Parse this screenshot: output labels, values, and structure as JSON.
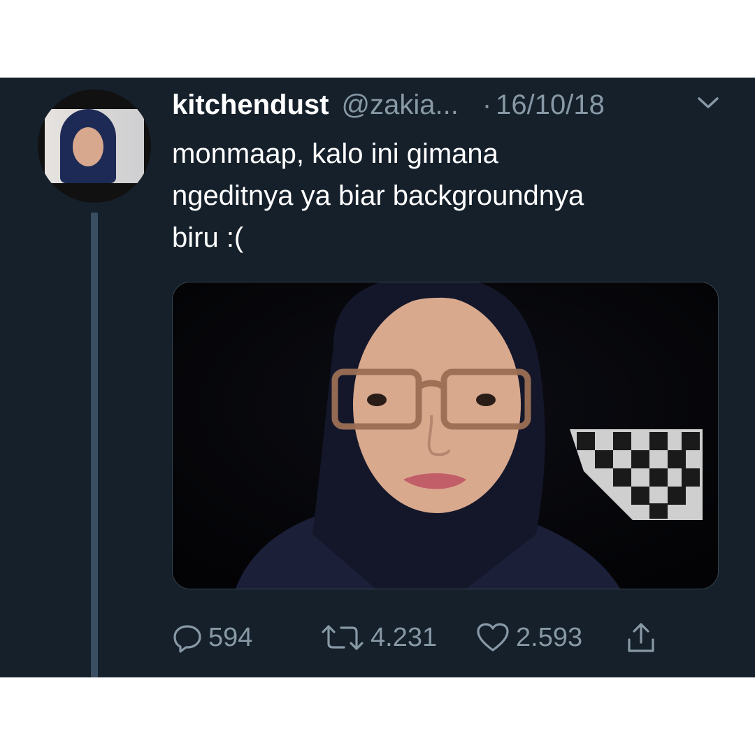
{
  "tweet": {
    "display_name": "kitchendust",
    "handle": "@zakia...",
    "separator": "·",
    "date": "16/10/18",
    "text": "monmaap, kalo ini gimana\nngeditnya ya biar backgroundnya\nbiru :("
  },
  "actions": {
    "reply_count": "594",
    "retweet_count": "4.231",
    "like_count": "2.593"
  },
  "icons": {
    "menu": "chevron-down-icon",
    "reply": "reply-icon",
    "retweet": "retweet-icon",
    "like": "heart-icon",
    "share": "share-icon"
  },
  "colors": {
    "background": "#15202b",
    "text_primary": "#ffffff",
    "text_secondary": "#8899a6",
    "thread_line": "#3b4f63"
  }
}
